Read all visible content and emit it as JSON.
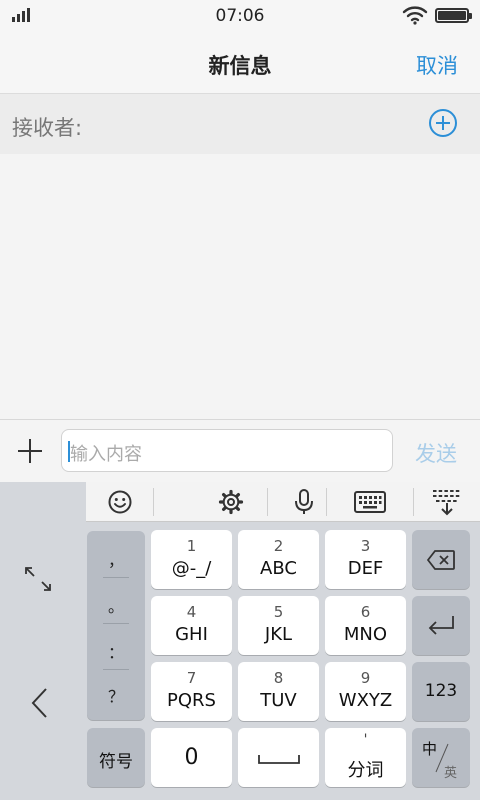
{
  "status_bar": {
    "time": "07:06"
  },
  "nav": {
    "title": "新信息",
    "cancel_label": "取消"
  },
  "recipient": {
    "label": "接收者:"
  },
  "compose": {
    "placeholder": "输入内容",
    "send_label": "发送"
  },
  "keyboard": {
    "punctuation": [
      "，",
      "。",
      "：",
      "？"
    ],
    "keys": [
      {
        "num": "1",
        "letters": "@-_/"
      },
      {
        "num": "2",
        "letters": "ABC"
      },
      {
        "num": "3",
        "letters": "DEF"
      },
      {
        "num": "4",
        "letters": "GHI"
      },
      {
        "num": "5",
        "letters": "JKL"
      },
      {
        "num": "6",
        "letters": "MNO"
      },
      {
        "num": "7",
        "letters": "PQRS"
      },
      {
        "num": "8",
        "letters": "TUV"
      },
      {
        "num": "9",
        "letters": "WXYZ"
      }
    ],
    "symbols_label": "符号",
    "zero_label": "0",
    "segment_mark": "'",
    "segment_label": "分词",
    "numeric_label": "123",
    "lang_primary": "中",
    "lang_secondary": "英"
  },
  "colors": {
    "accent": "#2c8fd7",
    "send_disabled": "#a9cde9",
    "key_dark": "#b7bcc4"
  }
}
